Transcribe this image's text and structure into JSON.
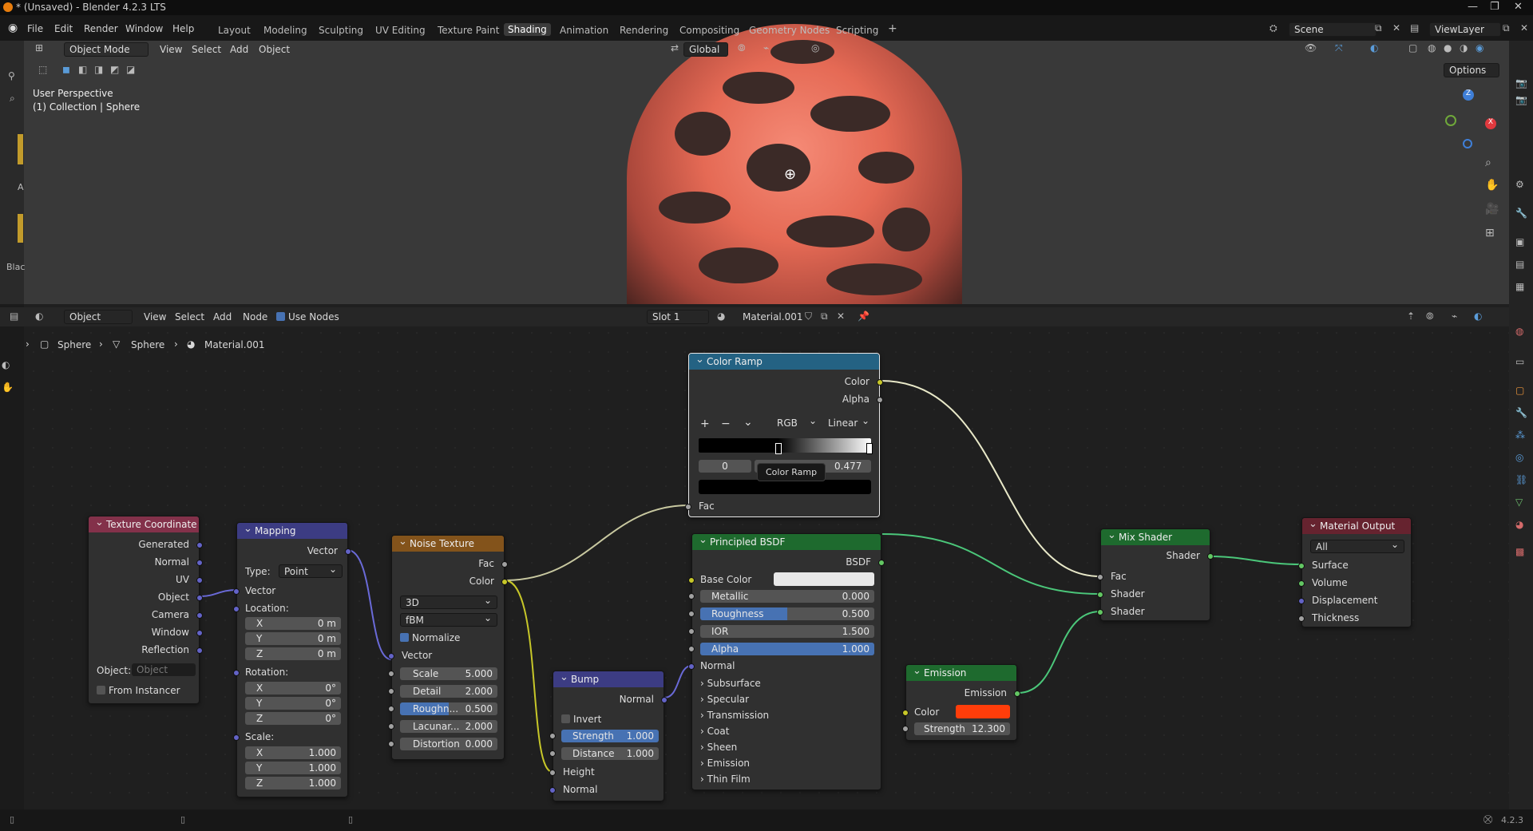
{
  "window": {
    "title": "* (Unsaved) - Blender 4.2.3 LTS"
  },
  "menu": {
    "file": "File",
    "edit": "Edit",
    "render": "Render",
    "window": "Window",
    "help": "Help"
  },
  "workspaces": [
    "Layout",
    "Modeling",
    "Sculpting",
    "UV Editing",
    "Texture Paint",
    "Shading",
    "Animation",
    "Rendering",
    "Compositing",
    "Geometry Nodes",
    "Scripting"
  ],
  "active_workspace": "Shading",
  "scene": {
    "name": "Scene",
    "view_layer": "ViewLayer"
  },
  "viewport": {
    "mode": "Object Mode",
    "menus": [
      "View",
      "Select",
      "Add",
      "Object"
    ],
    "orientation": "Global",
    "options": "Options",
    "overlay_line1": "User Perspective",
    "overlay_line2": "(1) Collection | Sphere",
    "left_labels": [
      "A",
      "Blac"
    ]
  },
  "node_header": {
    "type": "Object",
    "menus": [
      "View",
      "Select",
      "Add",
      "Node"
    ],
    "use_nodes": "Use Nodes",
    "slot": "Slot 1",
    "material": "Material.001"
  },
  "breadcrumb": [
    "Sphere",
    "Sphere",
    "Material.001"
  ],
  "nodes": {
    "texcoord": {
      "title": "Texture Coordinate",
      "outputs": [
        "Generated",
        "Normal",
        "UV",
        "Object",
        "Camera",
        "Window",
        "Reflection"
      ],
      "object_label": "Object:",
      "object_placeholder": "Object",
      "from_instancer": "From Instancer"
    },
    "mapping": {
      "title": "Mapping",
      "out": "Vector",
      "type_label": "Type:",
      "type_value": "Point",
      "vector": "Vector",
      "location": "Location:",
      "rotation": "Rotation:",
      "scale": "Scale:",
      "loc": [
        {
          "a": "X",
          "v": "0 m"
        },
        {
          "a": "Y",
          "v": "0 m"
        },
        {
          "a": "Z",
          "v": "0 m"
        }
      ],
      "rot": [
        {
          "a": "X",
          "v": "0°"
        },
        {
          "a": "Y",
          "v": "0°"
        },
        {
          "a": "Z",
          "v": "0°"
        }
      ],
      "scl": [
        {
          "a": "X",
          "v": "1.000"
        },
        {
          "a": "Y",
          "v": "1.000"
        },
        {
          "a": "Z",
          "v": "1.000"
        }
      ]
    },
    "noise": {
      "title": "Noise Texture",
      "fac": "Fac",
      "color": "Color",
      "dim": "3D",
      "type": "fBM",
      "normalize": "Normalize",
      "vector": "Vector",
      "fields": [
        {
          "l": "Scale",
          "v": "5.000"
        },
        {
          "l": "Detail",
          "v": "2.000"
        },
        {
          "l": "Roughn...",
          "v": "0.500"
        },
        {
          "l": "Lacunar...",
          "v": "2.000"
        },
        {
          "l": "Distortion",
          "v": "0.000"
        }
      ]
    },
    "ramp": {
      "title": "Color Ramp",
      "color": "Color",
      "alpha": "Alpha",
      "mode": "RGB",
      "interp": "Linear",
      "index": "0",
      "pos": "0.477",
      "fac": "Fac",
      "tooltip": "Color Ramp"
    },
    "bump": {
      "title": "Bump",
      "normal_out": "Normal",
      "invert": "Invert",
      "strength_l": "Strength",
      "strength_v": "1.000",
      "distance_l": "Distance",
      "distance_v": "1.000",
      "height": "Height",
      "normal_in": "Normal"
    },
    "bsdf": {
      "title": "Principled BSDF",
      "out": "BSDF",
      "base_color": "Base Color",
      "fields": [
        {
          "l": "Metallic",
          "v": "0.000"
        },
        {
          "l": "Roughness",
          "v": "0.500"
        },
        {
          "l": "IOR",
          "v": "1.500"
        },
        {
          "l": "Alpha",
          "v": "1.000"
        }
      ],
      "normal": "Normal",
      "panels": [
        "Subsurface",
        "Specular",
        "Transmission",
        "Coat",
        "Sheen",
        "Emission",
        "Thin Film"
      ]
    },
    "emission": {
      "title": "Emission",
      "out": "Emission",
      "color": "Color",
      "strength_l": "Strength",
      "strength_v": "12.300",
      "swatch": "#ff3d0a"
    },
    "mix": {
      "title": "Mix Shader",
      "out": "Shader",
      "fac": "Fac",
      "s1": "Shader",
      "s2": "Shader"
    },
    "output": {
      "title": "Material Output",
      "target": "All",
      "inputs": [
        "Surface",
        "Volume",
        "Displacement",
        "Thickness"
      ]
    }
  },
  "status": {
    "version": "4.2.3"
  },
  "colors": {
    "header_texcoord": "#83314a",
    "header_mapping": "#3c3c83",
    "header_noise": "#83531b",
    "header_ramp": "#246283",
    "header_shader": "#1e6a2e",
    "header_output": "#66232f",
    "accent": "#4772b3"
  }
}
